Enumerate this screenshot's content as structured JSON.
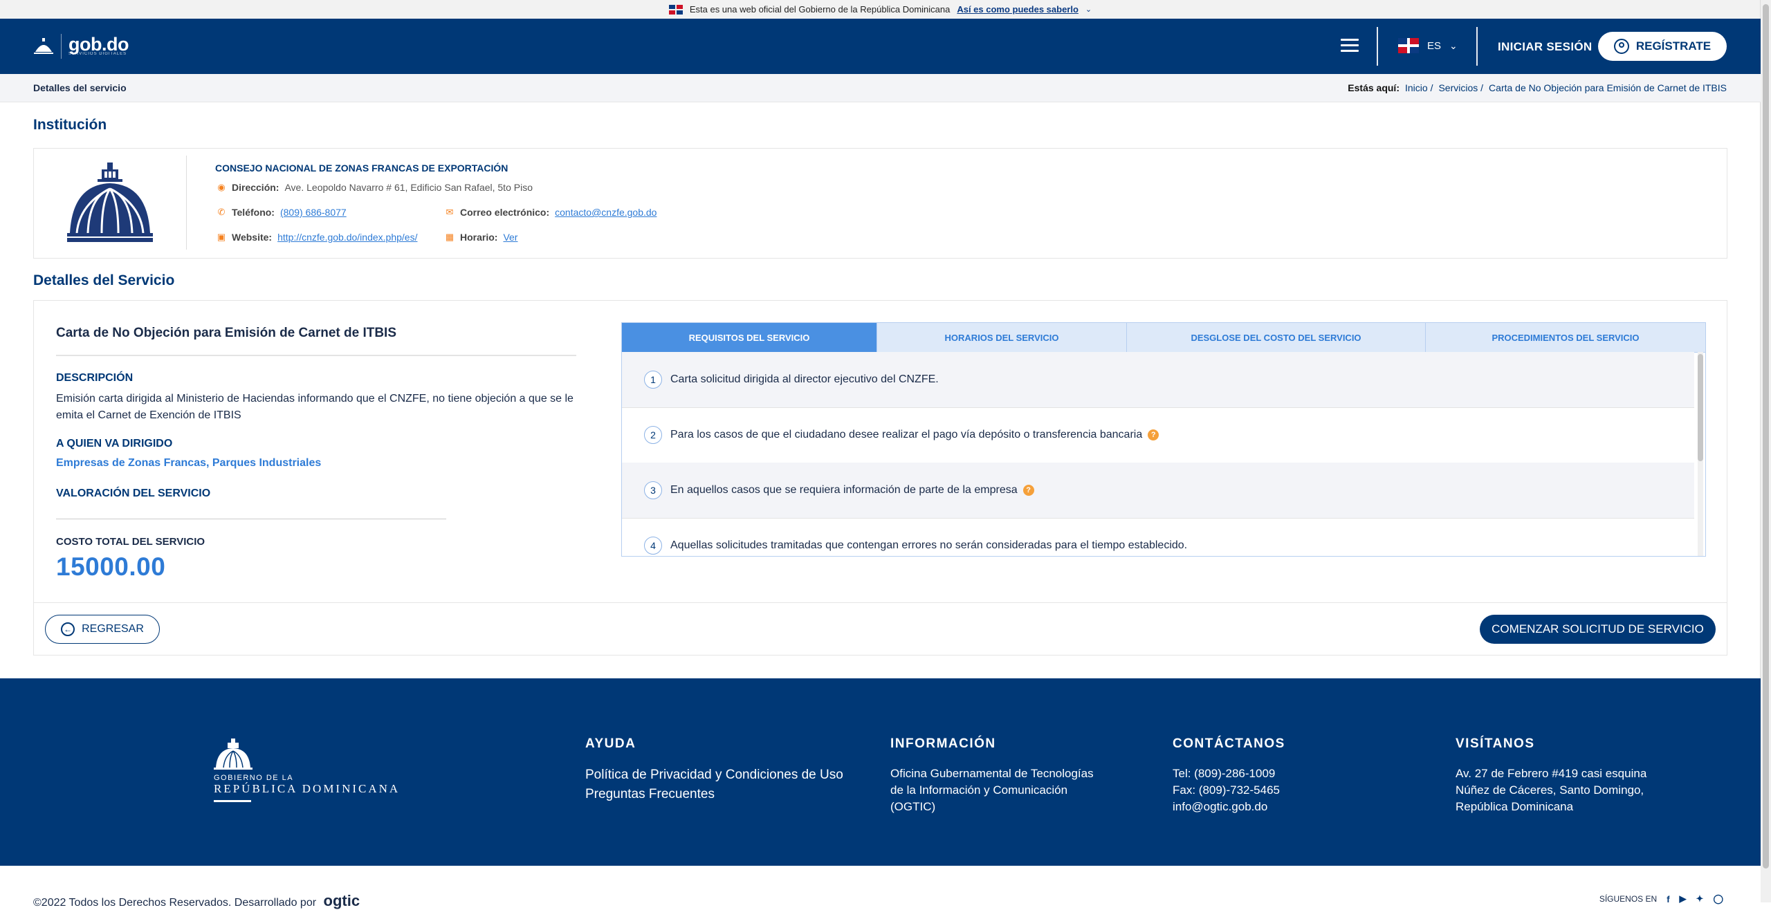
{
  "gov_banner": {
    "text": "Esta es una web oficial del Gobierno de la República Dominicana",
    "link": "Así es como puedes saberlo"
  },
  "header": {
    "logo": "gob.do",
    "logo_sub": "SERVICIOS DIGITALES",
    "language": "ES",
    "login": "INICIAR SESIÓN",
    "register": "REGÍSTRATE"
  },
  "breadcrumb": {
    "page": "Detalles del servicio",
    "here": "Estás aquí:",
    "items": [
      "Inicio /",
      "Servicios /",
      "Carta de No Objeción para Emisión de Carnet de ITBIS"
    ]
  },
  "institution": {
    "section_title": "Institución",
    "name": "CONSEJO NACIONAL DE ZONAS FRANCAS DE EXPORTACIÓN",
    "address_label": "Dirección:",
    "address": "Ave. Leopoldo Navarro # 61, Edificio San Rafael, 5to Piso",
    "phone_label": "Teléfono:",
    "phone": "(809) 686-8077",
    "email_label": "Correo electrónico:",
    "email": "contacto@cnzfe.gob.do",
    "website_label": "Website:",
    "website": "http://cnzfe.gob.do/index.php/es/",
    "hours_label": "Horario:",
    "hours": "Ver"
  },
  "service": {
    "section_title": "Detalles del Servicio",
    "title": "Carta de No Objeción para Emisión de Carnet de ITBIS",
    "description_label": "DESCRIPCIÓN",
    "description": "Emisión carta dirigida al Ministerio de Haciendas informando que el CNZFE, no tiene objeción a que se le emita el Carnet de Exención de ITBIS",
    "audience_label": "A QUIEN VA DIRIGIDO",
    "audience": "Empresas de Zonas Francas, Parques Industriales",
    "rating_label": "VALORACIÓN DEL SERVICIO",
    "cost_label": "COSTO TOTAL DEL SERVICIO",
    "cost": "15000.00",
    "tabs": [
      "REQUISITOS DEL SERVICIO",
      "HORARIOS DEL SERVICIO",
      "DESGLOSE DEL COSTO DEL SERVICIO",
      "PROCEDIMIENTOS DEL SERVICIO"
    ],
    "requirements": [
      {
        "num": "1",
        "text": "Carta solicitud dirigida al director ejecutivo del CNZFE."
      },
      {
        "num": "2",
        "text": "Para los casos de que el ciudadano desee realizar el pago vía depósito o transferencia bancaria"
      },
      {
        "num": "3",
        "text": "En aquellos casos que se requiera información de parte de la empresa"
      },
      {
        "num": "4",
        "text": "Aquellas solicitudes tramitadas que contengan errores no serán consideradas para el tiempo establecido."
      }
    ],
    "info_mark": "?",
    "back_button": "REGRESAR",
    "start_button": "COMENZAR SOLICITUD DE SERVICIO"
  },
  "footer": {
    "logo_small": "GOBIERNO DE LA",
    "logo_big": "REPÚBLICA DOMINICANA",
    "help": {
      "title": "AYUDA",
      "items": [
        "Política de Privacidad y Condiciones de Uso",
        "Preguntas Frecuentes"
      ]
    },
    "info": {
      "title": "INFORMACIÓN",
      "lines": [
        "Oficina Gubernamental de Tecnologías",
        "de la Información y Comunicación",
        "(OGTIC)"
      ]
    },
    "contact": {
      "title": "CONTÁCTANOS",
      "lines": [
        "Tel: (809)-286-1009",
        "Fax: (809)-732-5465",
        "info@ogtic.gob.do"
      ]
    },
    "visit": {
      "title": "VISÍTANOS",
      "lines": [
        "Av. 27 de Febrero #419 casi esquina",
        "Núñez de Cáceres, Santo Domingo,",
        "República Dominicana"
      ]
    },
    "copyright": "©2022 Todos los Derechos Reservados. Desarrollado por",
    "developer": "ogtic",
    "follow": "SÍGUENOS EN"
  },
  "colors": {
    "primary": "#003876",
    "accent": "#2e7bd6",
    "orange": "#f58220"
  }
}
